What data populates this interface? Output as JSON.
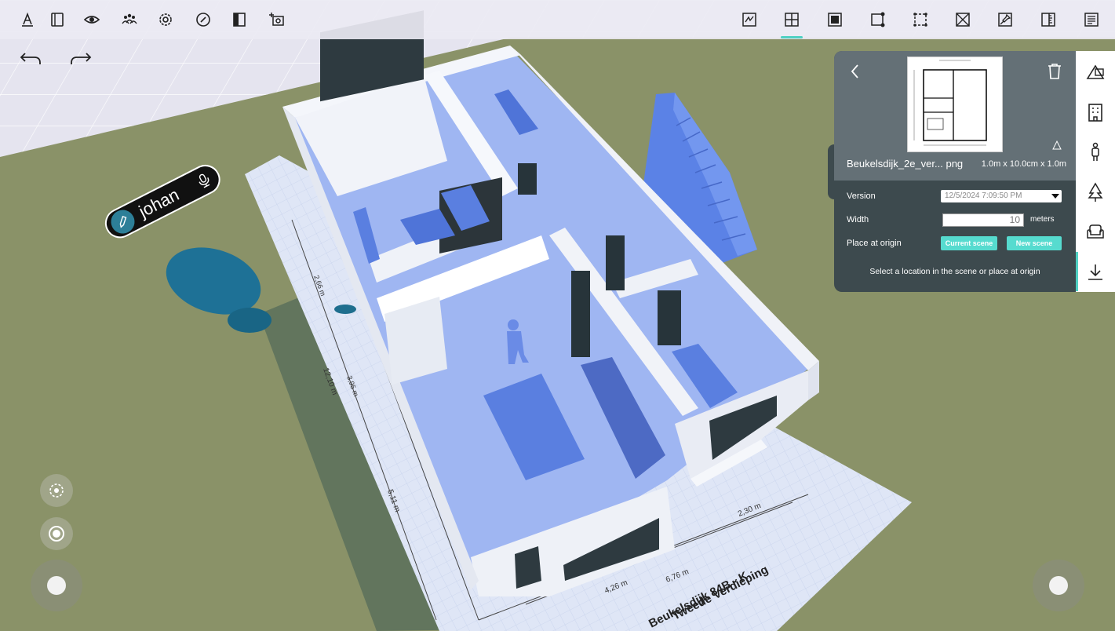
{
  "user": {
    "name": "johan"
  },
  "panel": {
    "file_name": "Beukelsdijk_2e_ver... png",
    "dimensions": "1.0m x 10.0cm x 1.0m",
    "version_label": "Version",
    "version_value": "12/5/2024 7:09:50 PM",
    "width_label": "Width",
    "width_value": "10",
    "width_unit": "meters",
    "place_label": "Place at origin",
    "current_scene": "Current scene",
    "new_scene": "New scene",
    "hint": "Select a location in the scene or place at origin"
  },
  "scene_labels": {
    "floor_title": "Tweede Verdieping",
    "floor_subtitle": "Beukelsdijk 84B - K",
    "dim_1": "12,10 m",
    "dim_2": "5,11 m",
    "dim_3": "3,95 m",
    "dim_4": "6,76 m",
    "dim_5": "4,26 m",
    "dim_6": "2,30 m",
    "dim_7": "2,66 m"
  },
  "colors": {
    "accent": "#4fd0c2",
    "panel": "#3d4a4e",
    "panel_top": "#647076",
    "ground": "#8a9066",
    "furniture": "#5a7fe0"
  },
  "toolbar_left_icons": [
    "text-style-icon",
    "panel-icon",
    "eye-icon",
    "users-icon",
    "settings-icon",
    "compass-icon",
    "split-view-icon",
    "add-camera-icon"
  ],
  "toolbar_right_icons": [
    "sketch-icon",
    "grid-plan-icon",
    "solid-square-icon",
    "node-square-icon",
    "dashed-square-icon",
    "cross-box-icon",
    "pin-icon",
    "ruler-icon",
    "list-panel-icon"
  ],
  "category_icons": [
    "shapes-icon",
    "building-icon",
    "person-icon",
    "tree-icon",
    "armchair-icon",
    "download-icon"
  ]
}
